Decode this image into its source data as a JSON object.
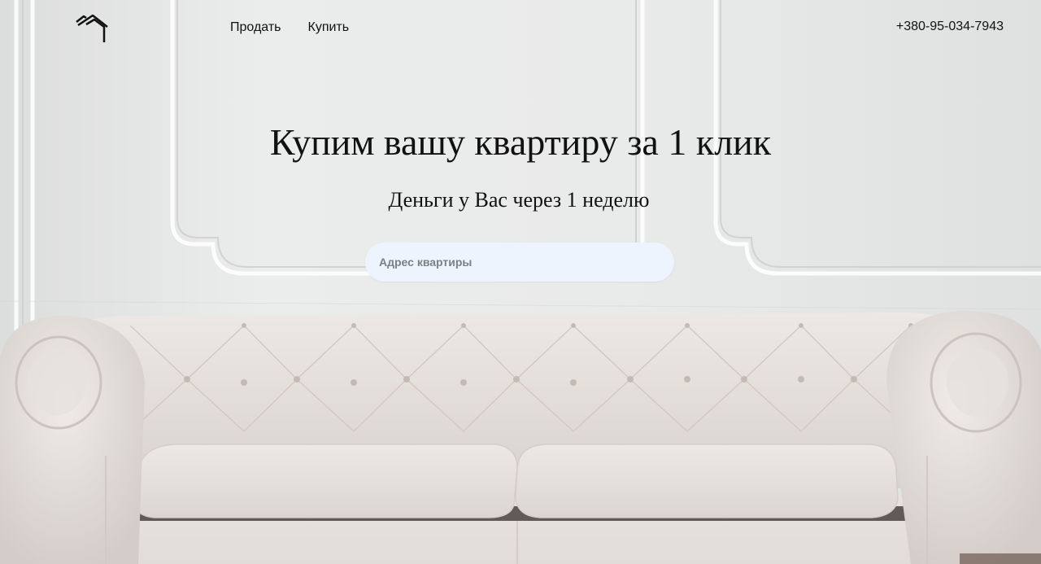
{
  "header": {
    "logo_icon": "house-icon",
    "nav": [
      {
        "label": "Продать"
      },
      {
        "label": "Купить"
      }
    ],
    "phone": "+380-95-034-7943"
  },
  "hero": {
    "title": "Купим вашу квартиру за 1 клик",
    "subtitle": "Деньги у Вас через 1 неделю",
    "search": {
      "placeholder": "Адрес квартиры",
      "value": ""
    },
    "background": "white-sofa-photo"
  },
  "colors": {
    "wall": "#e8e9e9",
    "sofa": "#e2dcd8",
    "input_bg": "#eef4fd",
    "text": "#111111"
  }
}
